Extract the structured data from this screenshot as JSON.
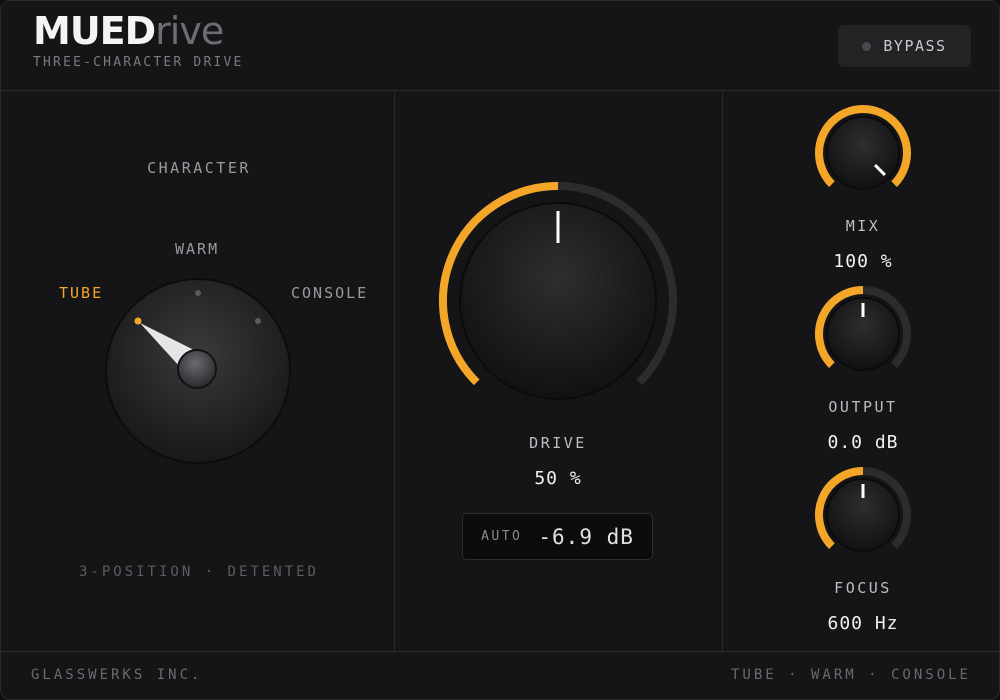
{
  "header": {
    "logo_bold": "MUED",
    "logo_light": "rive",
    "subtitle": "THREE-CHARACTER DRIVE",
    "bypass_label": "BYPASS"
  },
  "character": {
    "title": "CHARACTER",
    "positions": [
      "TUBE",
      "WARM",
      "CONSOLE"
    ],
    "selected": "TUBE",
    "footnote": "3-POSITION · DETENTED"
  },
  "drive": {
    "label": "DRIVE",
    "value": "50 %",
    "level": 0.5,
    "auto_label": "AUTO",
    "auto_value": "-6.9 dB"
  },
  "mix": {
    "label": "MIX",
    "value": "100 %",
    "level": 1.0
  },
  "output": {
    "label": "OUTPUT",
    "value": "0.0 dB",
    "level": 0.5
  },
  "focus": {
    "label": "FOCUS",
    "value": "600 Hz",
    "level": 0.5
  },
  "footer": {
    "brand": "GLASSWERKS INC.",
    "modes": "TUBE · WARM · CONSOLE"
  },
  "colors": {
    "accent": "#f4a629",
    "track": "#2c2c2f",
    "panel": "#151517"
  }
}
